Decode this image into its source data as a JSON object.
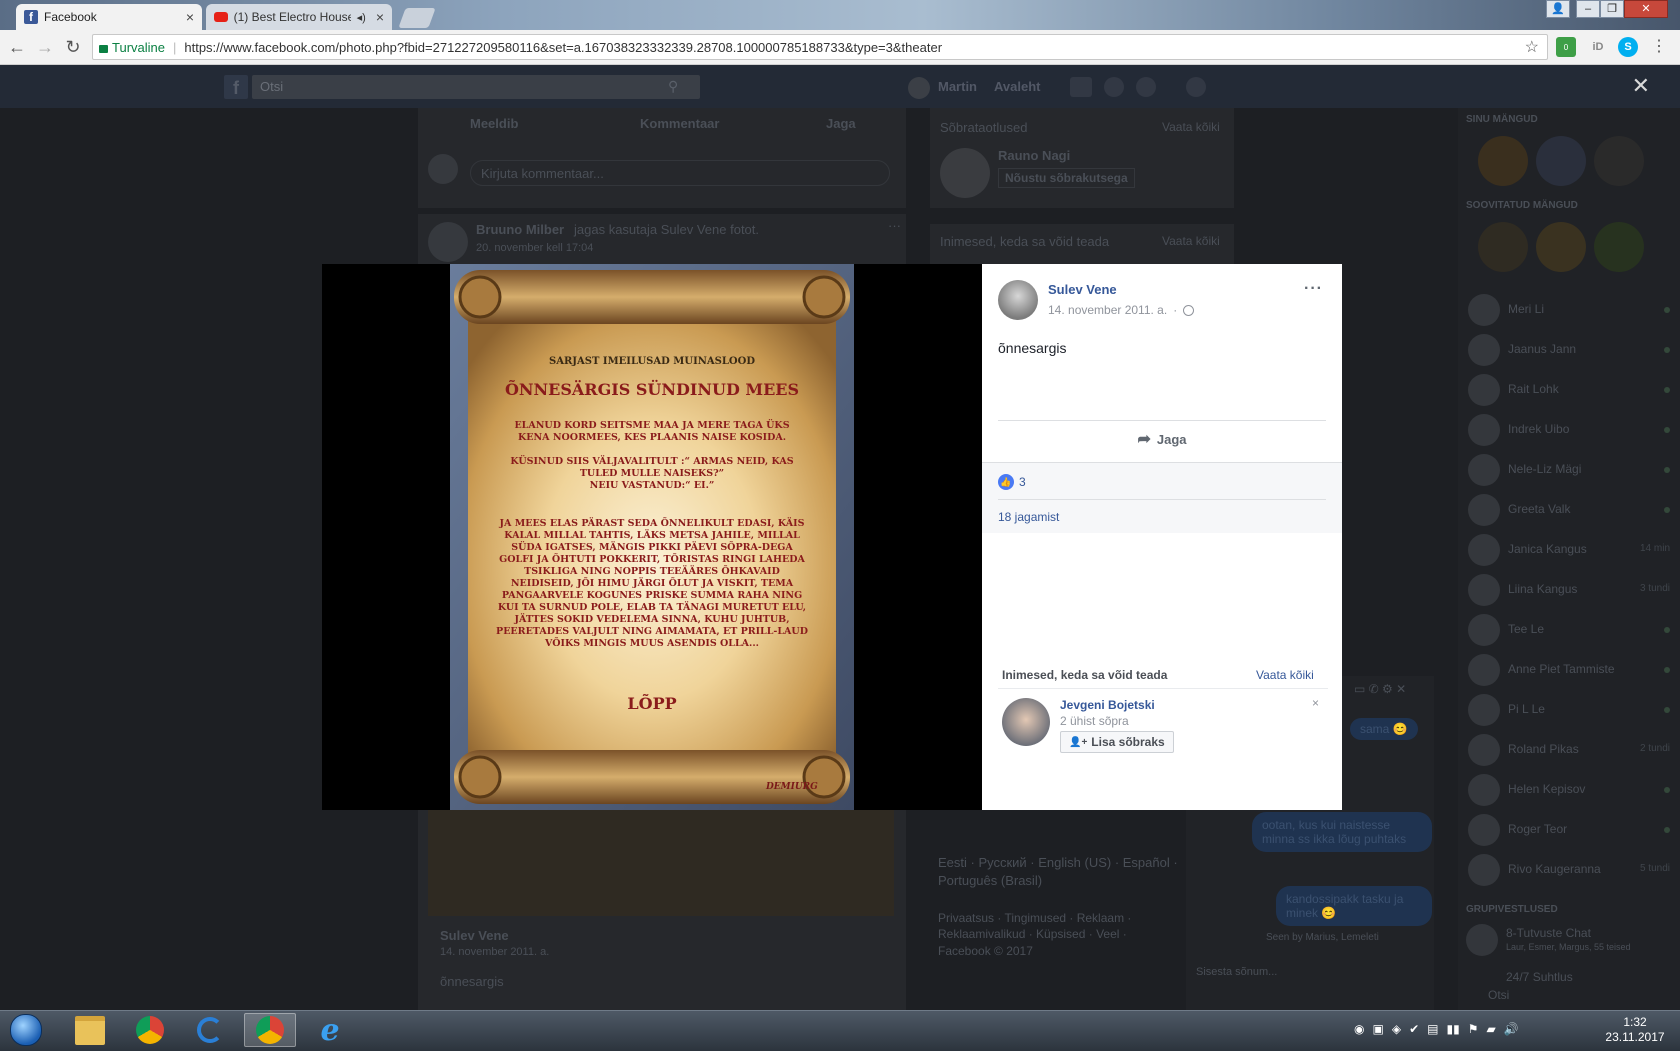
{
  "browser": {
    "tabs": [
      {
        "title": "Facebook",
        "icon": "facebook-favicon"
      },
      {
        "title": "(1) Best Electro House",
        "icon": "youtube-favicon"
      }
    ],
    "security_label": "Turvaline",
    "url": "https://www.facebook.com/photo.php?fbid=271227209580116&set=a.167038323332339.28708.100000785188733&type=3&theater",
    "ext_badge": "0",
    "ext_id_label": "iD"
  },
  "facebook_bg": {
    "search_placeholder": "Otsi",
    "header_user": "Martin",
    "header_home": "Avaleht",
    "action_like": "Meeldib",
    "action_comment": "Kommentaar",
    "action_share": "Jaga",
    "comment_placeholder": "Kirjuta kommentaar...",
    "post_author": "Bruuno Milber",
    "post_text": "jagas kasutaja Sulev Vene fotot.",
    "post_date": "20. november kell 17:04",
    "inner_author": "Sulev Vene",
    "inner_date": "14. november 2011. a.",
    "inner_text": "õnnesargis",
    "friend_requests_title": "Sõbrataotlused",
    "see_all": "Vaata kõiki",
    "request_name": "Rauno Nagi",
    "request_button": "Nõustu sõbrakutsega",
    "pymk_title": "Inimesed, keda sa võid teada",
    "languages": "Eesti · Русский · English (US) · Español · Português (Brasil)",
    "footer_links": "Privaatsus · Tingimused · Reklaam · Reklaamivalikud · Küpsised · Veel ·",
    "copyright": "Facebook © 2017",
    "your_games": "SINU MÄNGUD",
    "suggested_games": "SOOVITATUD MÄNGUD",
    "group_convos": "GRUPIVESTLUSED",
    "group1": "8-Tutvuste Chat",
    "group1_sub": "Laur, Esmer, Margus, 55 teised",
    "group2": "24/7 Suhtlus",
    "chat_search": "Otsi",
    "contacts": [
      "Meri Li",
      "Jaanus Jann",
      "Rait Lohk",
      "Indrek Uibo",
      "Nele-Liz Mägi",
      "Greeta Valk",
      "Janica Kangus",
      "Liina Kangus",
      "Tee Le",
      "Anne Piet Tammiste",
      "Pi L Le",
      "Roland Pikas",
      "Helen Kepisov",
      "Roger Teor",
      "Rivo Kaugeranna"
    ],
    "contact_times": [
      "",
      "",
      "",
      "",
      "",
      "",
      "14 min",
      "3 tundi",
      "",
      "",
      "",
      "2 tundi",
      "",
      "",
      "5 tundi"
    ],
    "chat_messages": [
      "sama 😊",
      "ootan, kus kui naistesse minna ss ikka lõug puhtaks",
      "kandossipakk tasku ja minek 😊"
    ],
    "chat_seen": "Seen by Marius, Lemeleti",
    "chat_input": "Sisesta sõnum..."
  },
  "photo": {
    "series": "SARJAST IMEILUSAD MUINASLOOD",
    "title": "ÕNNESÄRGIS SÜNDINUD MEES",
    "para1": "ELANUD KORD SEITSME MAA JA MERE TAGA ÜKS KENA NOORMEES, KES PLAANIS NAISE KOSIDA.",
    "para2": "KÜSINUD SIIS VÄLJAVALITULT :“ ARMAS NEID, KAS TULED MULLE NAISEKS?”",
    "para3": "NEIU VASTANUD:“ EI.”",
    "para4": "JA MEES ELAS PÄRAST SEDA ÕNNELIKULT EDASI, KÄIS KALAL MILLAL TAHTIS, LÄKS METSA JAHILE, MILLAL SÜDA IGATSES, MÄNGIS PIKKI PÄEVI SÕPRA-DEGA GOLFI JA ÕHTUTI POKKERIT, TÕRISTAS RINGI LAHEDA TSIKLIGA NING NOPPIS TEEÄÄRES ÕHKAVAID NEIDISEID, JÕI HIMU JÄRGI ÕLUT JA VISKIT, TEMA PANGAARVELE KOGUNES PRISKE SUMMA RAHA NING KUI TA SURNUD POLE, ELAB TA TÄNAGI MURETUT ELU, JÄTTES SOKID VEDELEMA SINNA, KUHU JUHTUB, PEERETADES VALJULT NING AIMAMATA, ET PRILL-LAUD VÕIKS MINGIS MUUS ASENDIS OLLA...",
    "end": "LÕPP",
    "signature": "DEMIURG"
  },
  "sidebar": {
    "author": "Sulev Vene",
    "date": "14. november 2011. a.",
    "caption": "õnnesargis",
    "share_label": "Jaga",
    "like_count": "3",
    "shares_label": "18 jagamist",
    "pymk_title": "Inimesed, keda sa võid teada",
    "see_all": "Vaata kõiki",
    "suggest_name": "Jevgeni Bojetski",
    "suggest_mutual": "2 ühist sõpra",
    "add_friend": "Lisa sõbraks"
  },
  "taskbar": {
    "time": "1:32",
    "date": "23.11.2017"
  },
  "colors": {
    "fb_blue": "#365899",
    "like_blue": "#4a7af4",
    "secure_green": "#0b8043"
  }
}
